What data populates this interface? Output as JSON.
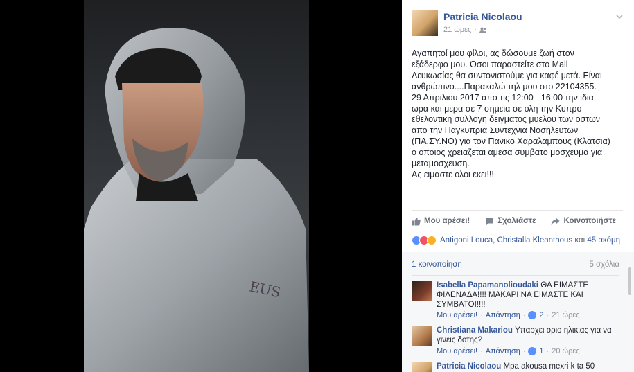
{
  "post": {
    "author": "Patricia Nicolaou",
    "time": "21 ώρες",
    "text": "Αγαπητοί μου φίλοι, ας δώσουμε ζωή στον\nεξάδερφο μου. Όσοι παραστείτε στο Mall\nΛευκωσίας θα συντονιστούμε για καφέ μετά. Είναι\nανθρώπινο....Παρακαλώ τηλ μου στο 22104355.\n29 Απριλιου 2017 απο τις 12:00 - 16:00 την ιδια\nωρα και μερα σε 7 σημεια σε ολη την Κυπρο -\nεθελοντικη συλλογη δειγματος μυελου των οστων\nαπο την Παγκυπρια Συντεχνια Νοσηλευτων\n(ΠΑ.ΣΥ.ΝΟ) για τον Πανικο Χαραλαμπους (Κλατσια)\nο οποιος χρειαζεται αμεσα συμβατο μοσχευμα για\nμεταμοσχευση.\nΑς ειμαστε ολοι εκει!!!"
  },
  "actions": {
    "like": "Μου αρέσει!",
    "comment": "Σχολιάστε",
    "share": "Κοινοποιήστε"
  },
  "reactions": {
    "names": "Antigoni Louca, Christalla Kleanthous",
    "connector": "και",
    "others": "45 ακόμη"
  },
  "stats": {
    "shares": "1 κοινοποίηση",
    "comments": "5 σχόλια"
  },
  "comments": [
    {
      "name": "Isabella Papamanolioudaki",
      "text": "ΘΑ ΕΙΜΑΣΤΕ ΦΙΛΕΝΑΔΑ!!!! ΜΑΚΑΡΙ ΝΑ ΕΙΜΑΣΤΕ ΚΑΙ ΣΥΜΒΑΤΟΙ!!!!",
      "like": "Μου αρέσει!",
      "reply": "Απάντηση",
      "likes": "2",
      "time": "21 ώρες"
    },
    {
      "name": "Christiana Makariou",
      "text": "Υπαρχει οριο ηλικιας για να γινεις δοτης?",
      "like": "Μου αρέσει!",
      "reply": "Απάντηση",
      "likes": "1",
      "time": "20 ώρες"
    },
    {
      "name": "Patricia Nicolaou",
      "text": "Mpa akousa mexri k ta 50"
    }
  ],
  "colors": {
    "link": "#365899",
    "meta": "#90949c",
    "text": "#1d2129",
    "action": "#616770"
  }
}
